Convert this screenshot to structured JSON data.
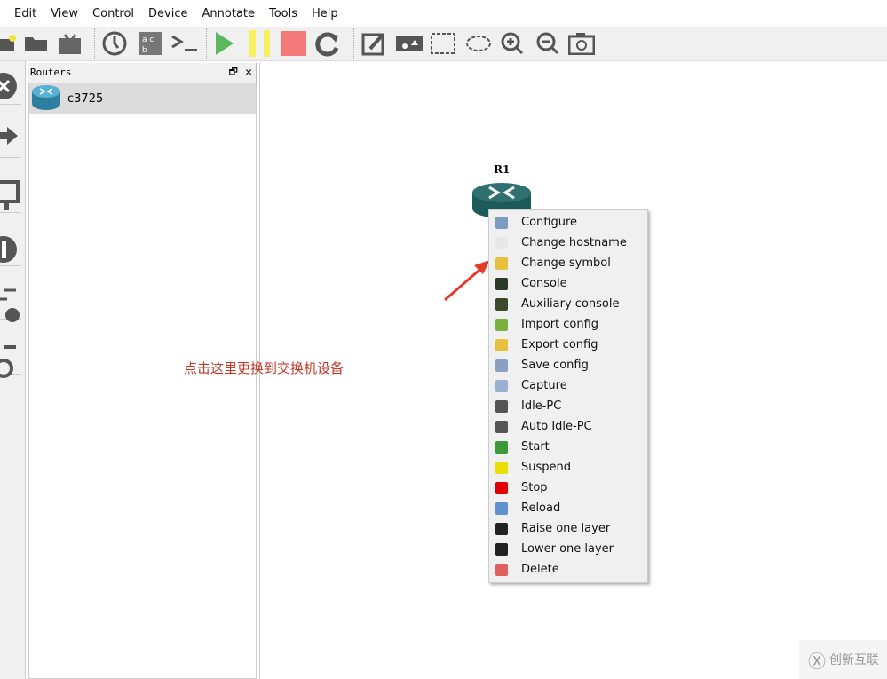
{
  "menubar": [
    "Edit",
    "View",
    "Control",
    "Device",
    "Annotate",
    "Tools",
    "Help"
  ],
  "panel": {
    "title": "Routers",
    "item": "c3725"
  },
  "device": {
    "label": "R1"
  },
  "annotation": "点击这里更换到交换机设备",
  "watermark": "创新互联",
  "context_menu": [
    {
      "label": "Configure",
      "icon": "wrench-icon",
      "color": "#7a9cc0"
    },
    {
      "label": "Change hostname",
      "icon": "hostname-icon",
      "color": "#e8e8e8"
    },
    {
      "label": "Change symbol",
      "icon": "symbol-icon",
      "color": "#e8c040"
    },
    {
      "label": "Console",
      "icon": "console-icon",
      "color": "#2a3a2a"
    },
    {
      "label": "Auxiliary console",
      "icon": "aux-console-icon",
      "color": "#3a4a2a"
    },
    {
      "label": "Import config",
      "icon": "import-icon",
      "color": "#7ab040"
    },
    {
      "label": "Export config",
      "icon": "export-icon",
      "color": "#e8c040"
    },
    {
      "label": "Save config",
      "icon": "save-icon",
      "color": "#8aa0c0"
    },
    {
      "label": "Capture",
      "icon": "magnifier-icon",
      "color": "#9ab0d0"
    },
    {
      "label": "Idle-PC",
      "icon": "calculator-icon",
      "color": "#555555"
    },
    {
      "label": "Auto Idle-PC",
      "icon": "calculator-icon",
      "color": "#555555"
    },
    {
      "label": "Start",
      "icon": "play-icon",
      "color": "#3a9a3a"
    },
    {
      "label": "Suspend",
      "icon": "pause-icon",
      "color": "#e8e000"
    },
    {
      "label": "Stop",
      "icon": "stop-icon",
      "color": "#e00000"
    },
    {
      "label": "Reload",
      "icon": "reload-icon",
      "color": "#6090d0"
    },
    {
      "label": "Raise one layer",
      "icon": "raise-layer-icon",
      "color": "#222222"
    },
    {
      "label": "Lower one layer",
      "icon": "lower-layer-icon",
      "color": "#222222"
    },
    {
      "label": "Delete",
      "icon": "delete-icon",
      "color": "#e06060"
    }
  ]
}
